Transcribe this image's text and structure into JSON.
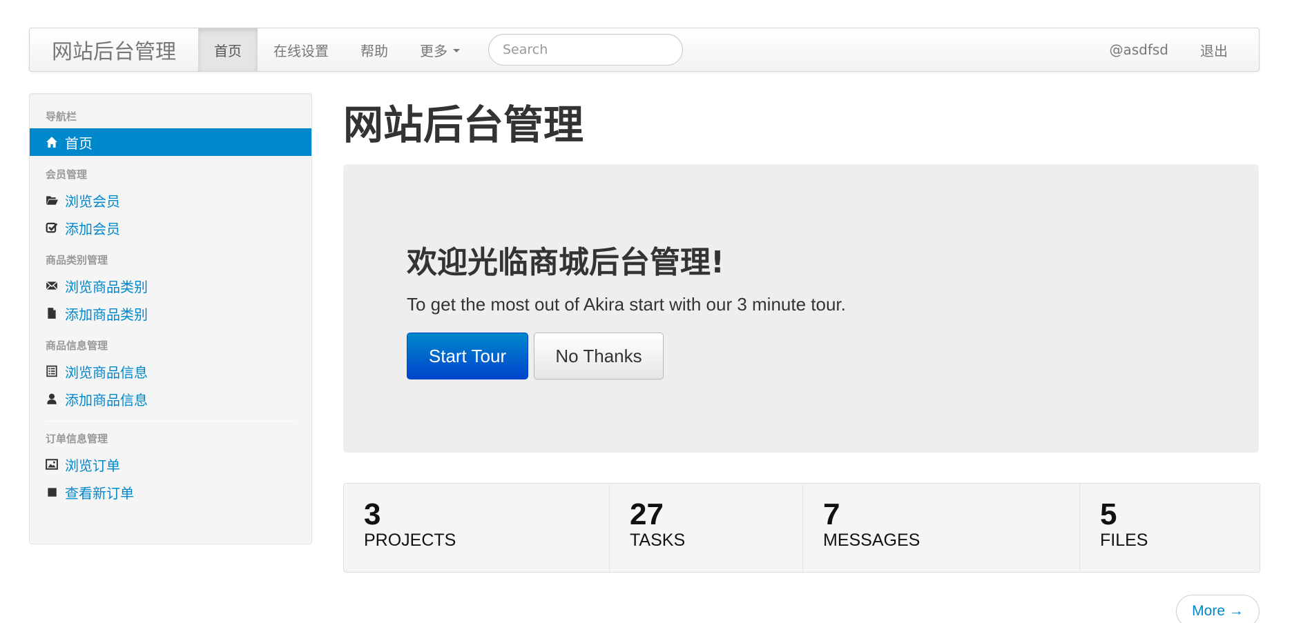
{
  "navbar": {
    "brand": "网站后台管理",
    "items": [
      {
        "label": "首页",
        "active": true
      },
      {
        "label": "在线设置",
        "active": false
      },
      {
        "label": "帮助",
        "active": false
      },
      {
        "label": "更多",
        "active": false
      }
    ],
    "search_placeholder": "Search",
    "user": "@asdfsd",
    "logout": "退出"
  },
  "sidebar": {
    "sections": [
      {
        "header": "导航栏",
        "items": [
          {
            "label": "首页",
            "icon": "home-icon",
            "active": true
          }
        ]
      },
      {
        "header": "会员管理",
        "items": [
          {
            "label": "浏览会员",
            "icon": "folder-open-icon"
          },
          {
            "label": "添加会员",
            "icon": "check-icon"
          }
        ]
      },
      {
        "header": "商品类别管理",
        "items": [
          {
            "label": "浏览商品类别",
            "icon": "envelope-icon"
          },
          {
            "label": "添加商品类别",
            "icon": "file-icon"
          }
        ]
      },
      {
        "header": "商品信息管理",
        "items": [
          {
            "label": "浏览商品信息",
            "icon": "list-alt-icon"
          },
          {
            "label": "添加商品信息",
            "icon": "user-icon"
          }
        ]
      },
      {
        "header": "订单信息管理",
        "items": [
          {
            "label": "浏览订单",
            "icon": "picture-icon"
          },
          {
            "label": "查看新订单",
            "icon": "stop-icon"
          }
        ]
      }
    ]
  },
  "main": {
    "title": "网站后台管理",
    "hero": {
      "title": "欢迎光临商城后台管理!",
      "text": "To get the most out of Akira start with our 3 minute tour.",
      "primary_button": "Start Tour",
      "secondary_button": "No Thanks"
    },
    "stats": [
      {
        "value": "3",
        "label": "PROJECTS"
      },
      {
        "value": "27",
        "label": "TASKS"
      },
      {
        "value": "7",
        "label": "MESSAGES"
      },
      {
        "value": "5",
        "label": "FILES"
      }
    ],
    "more_button": "More →"
  },
  "colors": {
    "accent": "#0088cc",
    "primary_button_top": "#0088cc",
    "primary_button_bottom": "#0044cc",
    "hero_background": "#eeeeee"
  }
}
